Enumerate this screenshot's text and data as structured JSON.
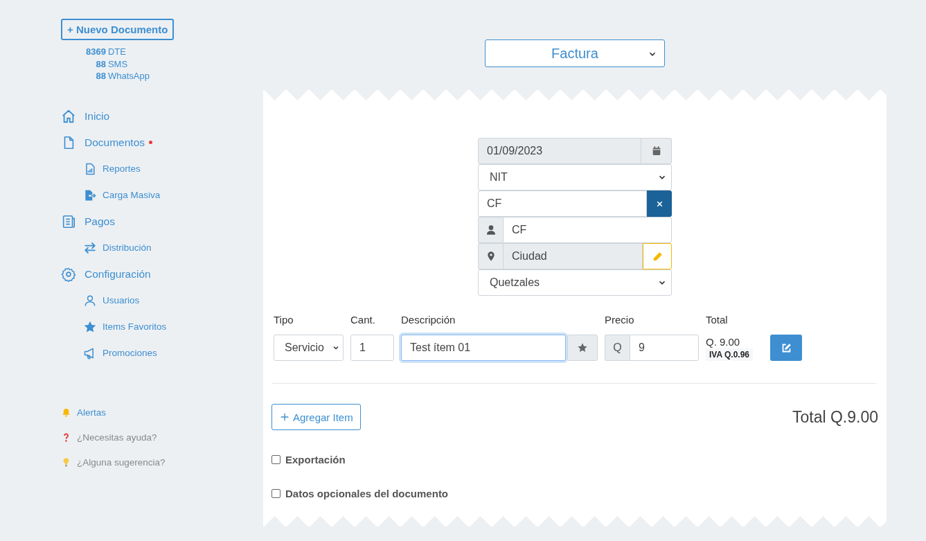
{
  "sidebar": {
    "new_button": "+ Nuevo Documento",
    "credits": [
      {
        "count": "8369",
        "label": "DTE"
      },
      {
        "count": "88",
        "label": "SMS"
      },
      {
        "count": "88",
        "label": "WhatsApp"
      }
    ],
    "nav": [
      {
        "label": "Inicio",
        "notification": false
      },
      {
        "label": "Documentos",
        "notification": true,
        "children": [
          {
            "label": "Reportes"
          },
          {
            "label": "Carga Masiva"
          }
        ]
      },
      {
        "label": "Pagos",
        "notification": false,
        "children": [
          {
            "label": "Distribución"
          }
        ]
      },
      {
        "label": "Configuración",
        "notification": false,
        "children": [
          {
            "label": "Usuarios"
          },
          {
            "label": "Items Favoritos"
          },
          {
            "label": "Promociones"
          }
        ]
      }
    ],
    "footer": [
      {
        "label": "Alertas",
        "kind": "link"
      },
      {
        "label": "¿Necesitas ayuda?",
        "kind": "help"
      },
      {
        "label": "¿Alguna sugerencia?",
        "kind": "help"
      }
    ]
  },
  "document_type": "Factura",
  "header_fields": [
    {
      "kind": "date",
      "value": "01/09/2023"
    },
    {
      "kind": "select",
      "value": "NIT"
    },
    {
      "kind": "clearable",
      "value": "CF"
    },
    {
      "kind": "person",
      "value": "CF"
    },
    {
      "kind": "location",
      "value": "Ciudad"
    },
    {
      "kind": "select",
      "value": "Quetzales"
    }
  ],
  "item_columns": [
    "Tipo",
    "Cant.",
    "Descripción",
    "Precio",
    "Total"
  ],
  "items": [
    {
      "type": "Servicio",
      "quantity": "1",
      "description": "Test ítem 01",
      "focused": true,
      "currency": "Q",
      "price": "9",
      "total": "Q. 9.00",
      "tax": "IVA Q.0.96"
    }
  ],
  "add_button": "Agregar Item",
  "grand_total": "Total Q.9.00",
  "options": [
    {
      "label": "Exportación",
      "checked": false
    },
    {
      "label": "Datos opcionales del documento",
      "checked": false
    }
  ]
}
